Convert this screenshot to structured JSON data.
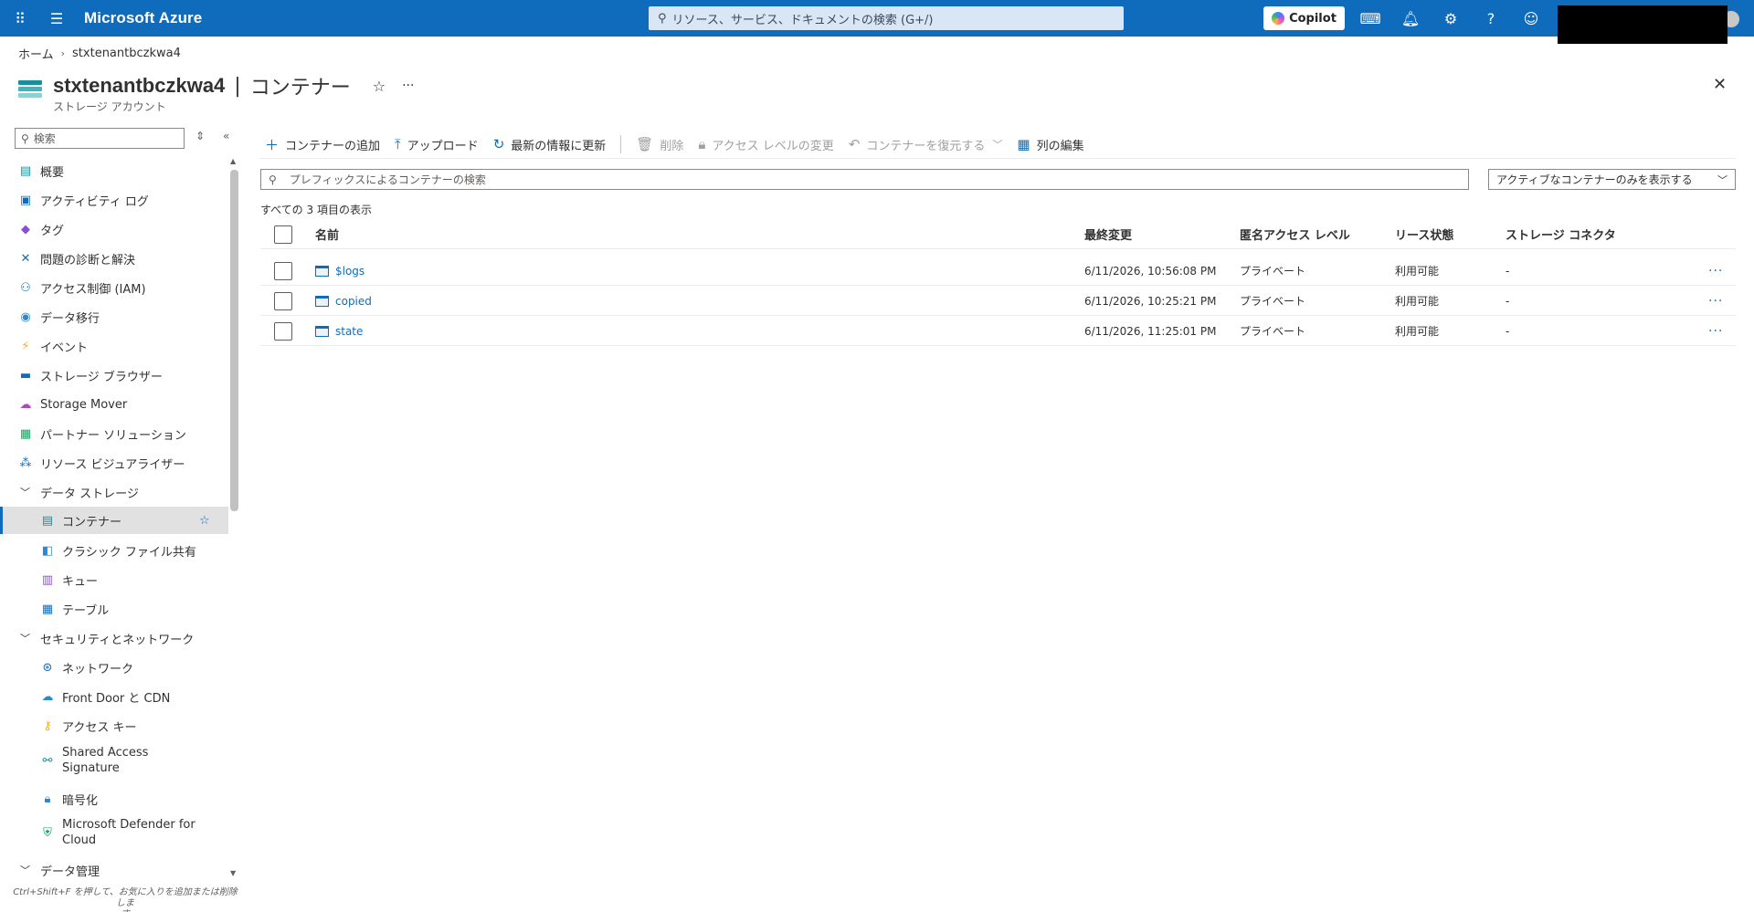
{
  "topbar": {
    "brand": "Microsoft Azure",
    "search_placeholder": "リソース、サービス、ドキュメントの検索 (G+/)",
    "copilot_label": "Copilot"
  },
  "breadcrumb": {
    "home": "ホーム",
    "current": "stxtenantbczkwa4"
  },
  "header": {
    "resource_name": "stxtenantbczkwa4",
    "pipe": "|",
    "page_name": "コンテナー",
    "subtitle": "ストレージ アカウント"
  },
  "sidebar": {
    "search_placeholder": "検索",
    "items": [
      {
        "label": "概要",
        "icon": "overview-icon"
      },
      {
        "label": "アクティビティ ログ",
        "icon": "activity-log-icon"
      },
      {
        "label": "タグ",
        "icon": "tag-icon"
      },
      {
        "label": "問題の診断と解決",
        "icon": "diagnose-icon"
      },
      {
        "label": "アクセス制御 (IAM)",
        "icon": "iam-icon"
      },
      {
        "label": "データ移行",
        "icon": "data-migration-icon"
      },
      {
        "label": "イベント",
        "icon": "events-icon"
      },
      {
        "label": "ストレージ ブラウザー",
        "icon": "storage-browser-icon"
      },
      {
        "label": "Storage Mover",
        "icon": "storage-mover-icon"
      },
      {
        "label": "パートナー ソリューション",
        "icon": "partner-icon"
      },
      {
        "label": "リソース ビジュアライザー",
        "icon": "visualizer-icon"
      }
    ],
    "group_data_storage": "データ ストレージ",
    "data_storage_items": [
      {
        "label": "コンテナー",
        "icon": "container-icon"
      },
      {
        "label": "クラシック ファイル共有",
        "icon": "file-share-icon"
      },
      {
        "label": "キュー",
        "icon": "queue-icon"
      },
      {
        "label": "テーブル",
        "icon": "table-icon"
      }
    ],
    "group_security": "セキュリティとネットワーク",
    "security_items": [
      {
        "label": "ネットワーク",
        "icon": "network-icon"
      },
      {
        "label": "Front Door と CDN",
        "icon": "cdn-icon"
      },
      {
        "label": "アクセス キー",
        "icon": "key-icon"
      },
      {
        "label_line1": "Shared Access",
        "label_line2": "Signature",
        "icon": "sas-icon"
      },
      {
        "label": "暗号化",
        "icon": "encryption-icon"
      },
      {
        "label_line1": "Microsoft Defender for",
        "label_line2": "Cloud",
        "icon": "defender-icon"
      }
    ],
    "group_data_mgmt": "データ管理",
    "hint_line1": "Ctrl+Shift+F を押して、お気に入りを追加または削除しま",
    "hint_line2": "す"
  },
  "toolbar": {
    "add": "コンテナーの追加",
    "upload": "アップロード",
    "refresh": "最新の情報に更新",
    "delete": "削除",
    "change_access": "アクセス レベルの変更",
    "restore": "コンテナーを復元する",
    "edit_columns": "列の編集"
  },
  "filter": {
    "placeholder": "プレフィックスによるコンテナーの検索",
    "dropdown_value": "アクティブなコンテナーのみを表示する"
  },
  "count_text": "すべての 3 項目の表示",
  "table": {
    "headers": {
      "name": "名前",
      "modified": "最終変更",
      "access": "匿名アクセス レベル",
      "lease": "リース状態",
      "connector": "ストレージ コネクタ"
    },
    "rows": [
      {
        "name": "$logs",
        "modified": "6/11/2026, 10:56:08 PM",
        "access": "プライベート",
        "lease": "利用可能",
        "connector": "-"
      },
      {
        "name": "copied",
        "modified": "6/11/2026, 10:25:21 PM",
        "access": "プライベート",
        "lease": "利用可能",
        "connector": "-"
      },
      {
        "name": "state",
        "modified": "6/11/2026, 11:25:01 PM",
        "access": "プライベート",
        "lease": "利用可能",
        "connector": "-"
      }
    ]
  },
  "colors": {
    "azure_blue": "#0f6cbd",
    "selected_bg": "#e1e1e1"
  }
}
